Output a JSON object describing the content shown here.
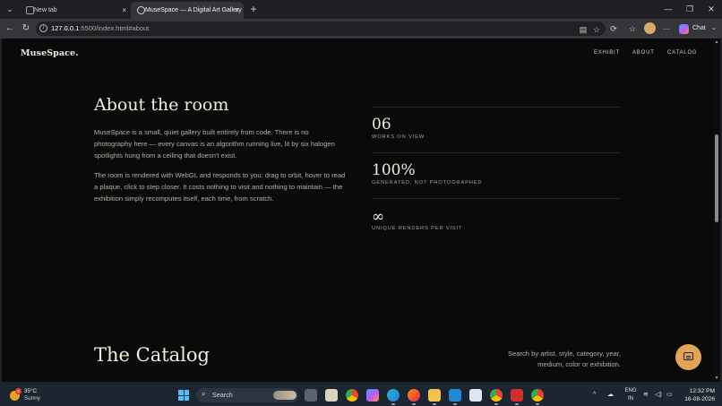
{
  "browser": {
    "tabs": [
      {
        "title": "New tab",
        "active": false
      },
      {
        "title": "MuseSpace — A Digital Art Gallery",
        "active": true
      }
    ],
    "tab_close_glyph": "×",
    "new_tab_glyph": "+",
    "window_controls": {
      "minimize": "—",
      "maximize": "❐",
      "close": "✕"
    },
    "address": {
      "host": "127.0.0.1",
      "rest": ":5500/index.html#about"
    },
    "chat_label": "Chat"
  },
  "site": {
    "logo": "MuseSpace.",
    "nav": [
      "EXHIBIT",
      "ABOUT",
      "CATALOG"
    ]
  },
  "about": {
    "heading": "About the room",
    "paragraphs": [
      "MuseSpace is a small, quiet gallery built entirely from code. There is no photography here — every canvas is an algorithm running live, lit by six halogen spotlights hung from a ceiling that doesn't exist.",
      "The room is rendered with WebGL and responds to you: drag to orbit, hover to read a plaque, click to step closer. It costs nothing to visit and nothing to maintain — the exhibition simply recomputes itself, each time, from scratch."
    ],
    "stats": [
      {
        "value": "06",
        "label": "WORKS ON VIEW"
      },
      {
        "value": "100%",
        "label": "GENERATED, NOT PHOTOGRAPHED"
      },
      {
        "value": "∞",
        "label": "UNIQUE RENDERS PER VISIT"
      }
    ]
  },
  "catalog": {
    "heading": "The Catalog",
    "description": "Search by artist, style, category, year, medium, color or exhibition."
  },
  "taskbar": {
    "weather": {
      "temp": "35°C",
      "condition": "Sunny",
      "badge": "2"
    },
    "search_label": "Search",
    "language": {
      "line1": "ENG",
      "line2": "IN"
    },
    "clock": {
      "time": "12:32 PM",
      "date": "16-08-2026"
    }
  },
  "colors": {
    "page_bg": "#0a0a0a",
    "heading": "#f2ece0",
    "body_text": "#b5afa4",
    "accent_fab": "#e3a456"
  },
  "icons": {
    "tab_search": "tab-search-icon",
    "back": "back-arrow-icon",
    "reload": "reload-icon",
    "site_info": "info-icon",
    "reading_mode": "reading-mode-icon",
    "favorite": "star-icon",
    "extensions": "extensions-icon",
    "favorites_bar": "favorites-icon",
    "more": "more-icon",
    "chat_fab": "chat-bubble-icon"
  }
}
